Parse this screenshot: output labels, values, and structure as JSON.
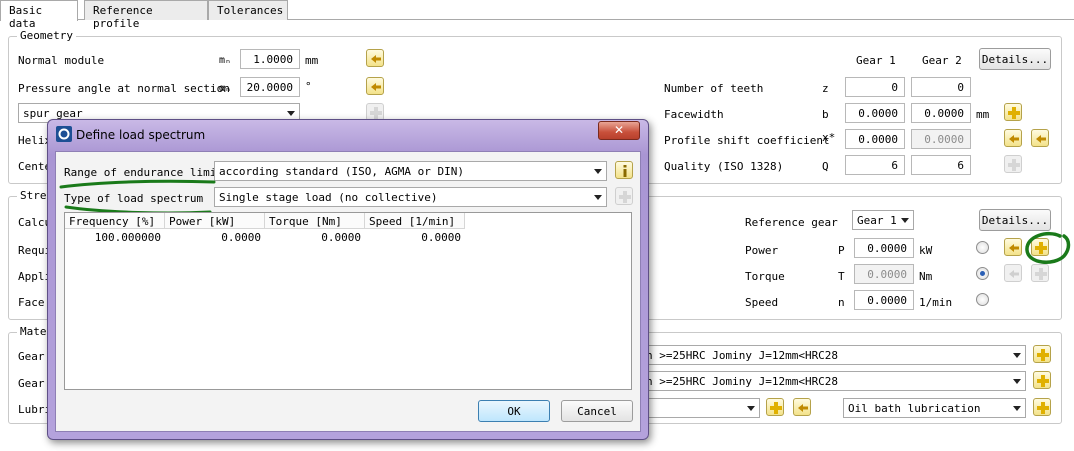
{
  "tabs": [
    "Basic data",
    "Reference profile",
    "Tolerances"
  ],
  "geometry": {
    "title": "Geometry",
    "normal_module": {
      "label": "Normal module",
      "symbol": "mₙ",
      "value": "1.0000",
      "unit": "mm"
    },
    "pressure_angle": {
      "label": "Pressure angle at normal section",
      "symbol": "αₙ",
      "value": "20.0000",
      "unit": "°"
    },
    "gear_type": "spur gear",
    "helix_label": "Helix",
    "center_label": "Cente",
    "gear1": "Gear 1",
    "gear2": "Gear 2",
    "details": "Details...",
    "rows": [
      {
        "label": "Number of teeth",
        "symbol": "z",
        "v1": "0",
        "v2": "0",
        "unit": ""
      },
      {
        "label": "Facewidth",
        "symbol": "b",
        "v1": "0.0000",
        "v2": "0.0000",
        "unit": "mm"
      },
      {
        "label": "Profile shift coefficient",
        "symbol": "x*",
        "v1": "0.0000",
        "v2": "0.0000",
        "unit": ""
      },
      {
        "label": "Quality (ISO 1328)",
        "symbol": "Q",
        "v1": "6",
        "v2": "6",
        "unit": ""
      }
    ]
  },
  "strength": {
    "title": "Stren",
    "left_labels": [
      "Calcu",
      "Requi",
      "Appli",
      "Face"
    ],
    "reference_gear_label": "Reference gear",
    "reference_gear_value": "Gear 1",
    "details": "Details...",
    "power": {
      "label": "Power",
      "symbol": "P",
      "value": "0.0000",
      "unit": "kW"
    },
    "torque": {
      "label": "Torque",
      "symbol": "T",
      "value": "0.0000",
      "unit": "Nm"
    },
    "speed": {
      "label": "Speed",
      "symbol": "n",
      "value": "0.0000",
      "unit": "1/min"
    }
  },
  "material": {
    "title": "Mater",
    "left_labels": [
      "Gear",
      "Gear",
      "Lubri"
    ],
    "gear1_material": "h >=25HRC Jominy J=12mm<HRC28",
    "gear2_material": "h >=25HRC Jominy J=12mm<HRC28",
    "lubrication_type": "Oil bath lubrication"
  },
  "dialog": {
    "title": "Define load spectrum",
    "close": "✕",
    "range_label": "Range of endurance limit",
    "range_value": "according standard (ISO, AGMA or DIN)",
    "type_label": "Type of load spectrum",
    "type_value": "Single stage load (no collective)",
    "columns": [
      "Frequency [%]",
      "Power [kW]",
      "Torque [Nm]",
      "Speed [1/min]"
    ],
    "rows": [
      [
        "100.000000",
        "0.0000",
        "0.0000",
        "0.0000"
      ]
    ],
    "ok": "OK",
    "cancel": "Cancel"
  },
  "colors": {
    "annotation_green": "#1a7a1a",
    "dialog_frame": "#b4a2dc",
    "close_red": "#c8503b"
  }
}
